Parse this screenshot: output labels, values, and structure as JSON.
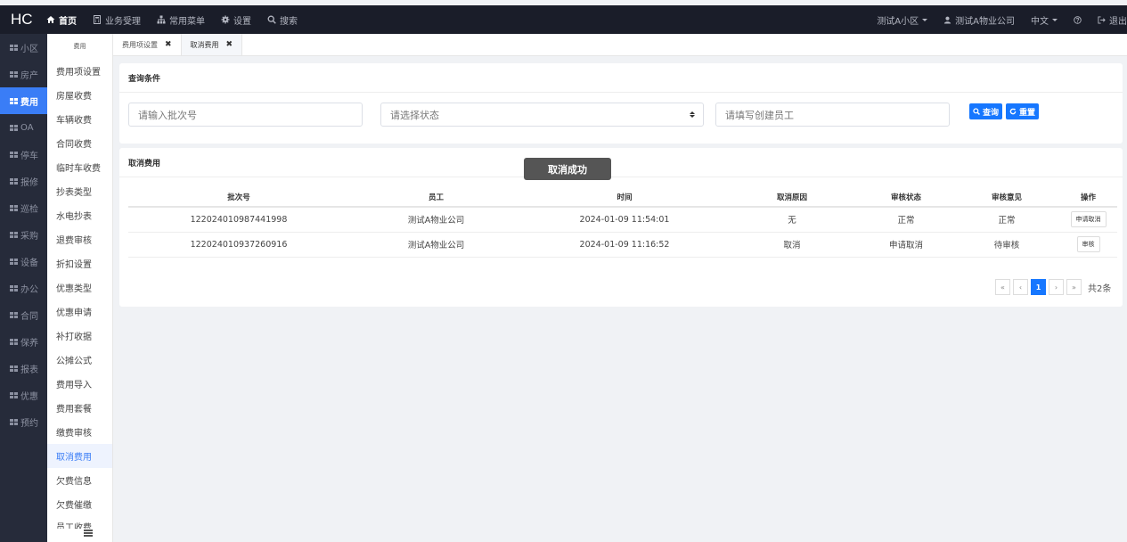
{
  "topbar": {
    "logo": "HC",
    "nav": [
      {
        "label": "首页",
        "icon": "home-icon",
        "active": true
      },
      {
        "label": "业务受理",
        "icon": "calculator-icon"
      },
      {
        "label": "常用菜单",
        "icon": "sitemap-icon"
      },
      {
        "label": "设置",
        "icon": "gear-icon"
      },
      {
        "label": "搜索",
        "icon": "search-icon"
      }
    ],
    "community": "测试A小区",
    "user": "测试A物业公司",
    "language": "中文",
    "help_icon": "question-icon",
    "logout": "退出"
  },
  "sidebar_primary": {
    "items": [
      {
        "label": "小区"
      },
      {
        "label": "房产"
      },
      {
        "label": "费用",
        "active": true
      },
      {
        "label": "OA"
      },
      {
        "label": "停车"
      },
      {
        "label": "报修"
      },
      {
        "label": "巡检"
      },
      {
        "label": "采购"
      },
      {
        "label": "设备"
      },
      {
        "label": "办公"
      },
      {
        "label": "合同"
      },
      {
        "label": "保养"
      },
      {
        "label": "报表"
      },
      {
        "label": "优惠"
      },
      {
        "label": "预约"
      }
    ]
  },
  "sidebar_secondary": {
    "header": "费用",
    "items": [
      {
        "label": "费用项设置"
      },
      {
        "label": "房屋收费"
      },
      {
        "label": "车辆收费"
      },
      {
        "label": "合同收费"
      },
      {
        "label": "临时车收费"
      },
      {
        "label": "抄表类型"
      },
      {
        "label": "水电抄表"
      },
      {
        "label": "退费审核"
      },
      {
        "label": "折扣设置"
      },
      {
        "label": "优惠类型"
      },
      {
        "label": "优惠申请"
      },
      {
        "label": "补打收据"
      },
      {
        "label": "公摊公式"
      },
      {
        "label": "费用导入"
      },
      {
        "label": "费用套餐"
      },
      {
        "label": "缴费审核"
      },
      {
        "label": "取消费用",
        "active": true
      },
      {
        "label": "欠费信息"
      },
      {
        "label": "欠费催缴"
      },
      {
        "label": "员工收费"
      }
    ]
  },
  "tabs": [
    {
      "label": "费用项设置"
    },
    {
      "label": "取消费用",
      "active": true
    }
  ],
  "query": {
    "title": "查询条件",
    "batch_placeholder": "请输入批次号",
    "status_placeholder": "请选择状态",
    "staff_placeholder": "请填写创建员工",
    "search_label": "查询",
    "reset_label": "重置"
  },
  "list": {
    "title": "取消费用",
    "columns": [
      "批次号",
      "员工",
      "时间",
      "取消原因",
      "审核状态",
      "审核意见",
      "操作"
    ],
    "rows": [
      {
        "batch": "122024010987441998",
        "staff": "测试A物业公司",
        "time": "2024-01-09 11:54:01",
        "reason": "无",
        "status": "正常",
        "opinion": "正常",
        "action": "申请取消"
      },
      {
        "batch": "122024010937260916",
        "staff": "测试A物业公司",
        "time": "2024-01-09 11:16:52",
        "reason": "取消",
        "status": "申请取消",
        "opinion": "待审核",
        "action": "审核"
      }
    ]
  },
  "pagination": {
    "first": "«",
    "prev": "‹",
    "current": "1",
    "next": "›",
    "last": "»",
    "total": "共2条"
  },
  "toast": "取消成功",
  "colors": {
    "accent": "#1677ff",
    "topbar": "#1a1d29",
    "sidebar": "#262b3a",
    "active_nav": "#3a7df6"
  }
}
